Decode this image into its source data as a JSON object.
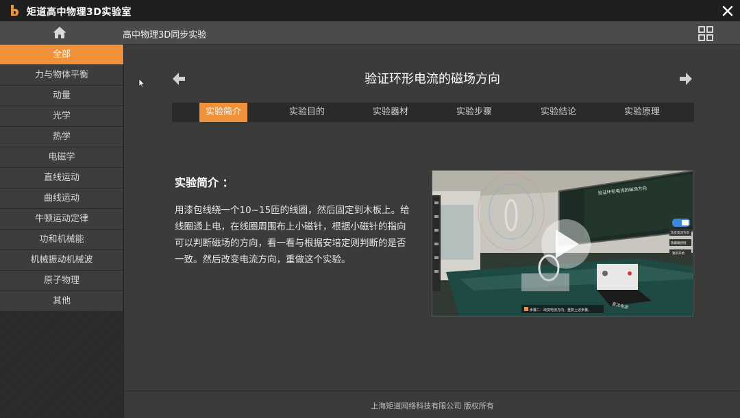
{
  "app": {
    "title": "矩道高中物理3D实验室"
  },
  "header": {
    "subtitle": "高中物理3D同步实验"
  },
  "sidebar": {
    "items": [
      {
        "label": "全部",
        "active": true
      },
      {
        "label": "力与物体平衡"
      },
      {
        "label": "动量"
      },
      {
        "label": "光学"
      },
      {
        "label": "热学"
      },
      {
        "label": "电磁学"
      },
      {
        "label": "直线运动"
      },
      {
        "label": "曲线运动"
      },
      {
        "label": "牛顿运动定律"
      },
      {
        "label": "功和机械能"
      },
      {
        "label": "机械振动机械波"
      },
      {
        "label": "原子物理"
      },
      {
        "label": "其他"
      }
    ]
  },
  "main": {
    "experiment_title": "验证环形电流的磁场方向",
    "tabs": [
      {
        "label": "实验简介",
        "active": true
      },
      {
        "label": "实验目的"
      },
      {
        "label": "实验器材"
      },
      {
        "label": "实验步骤"
      },
      {
        "label": "实验结论"
      },
      {
        "label": "实验原理"
      }
    ],
    "intro_heading": "实验简介 ：",
    "intro_text": "用漆包线绕一个10~15匝的线圈，然后固定到木板上。给线圈通上电，在线圈周围布上小磁针，根据小磁针的指向可以判断磁场的方向，看一看与根据安培定则判断的是否一致。然后改变电流方向，重做这个实验。",
    "video": {
      "board_title": "验证环形电流的磁场方向",
      "panel_buttons": [
        "改变电流方向",
        "隐藏磁感线",
        "重新开始"
      ],
      "caption": "步骤二：改变电流方向，重复上述步骤。",
      "device_label": "直流电源"
    }
  },
  "footer": {
    "text": "上海矩道网络科技有限公司  版权所有"
  },
  "colors": {
    "accent": "#f0913a",
    "titlebar": "#1f1f1f",
    "header": "#4b4b4b",
    "main_bg": "#3b3b3b"
  }
}
